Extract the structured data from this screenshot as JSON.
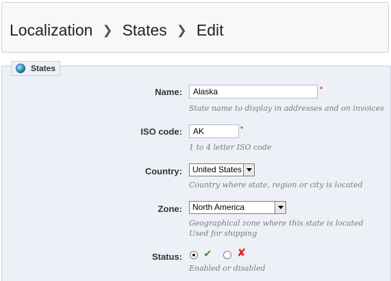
{
  "breadcrumb": {
    "items": [
      "Localization",
      "States",
      "Edit"
    ]
  },
  "fieldset": {
    "legend": "States"
  },
  "form": {
    "name": {
      "label": "Name:",
      "value": "Alaska",
      "required": "*",
      "hint": "State name to display in addresses and on invoices"
    },
    "iso_code": {
      "label": "ISO code:",
      "value": "AK",
      "required": "*",
      "hint": "1 to 4 letter ISO code"
    },
    "country": {
      "label": "Country:",
      "selected": "United States",
      "hint": "Country where state, region or city is located"
    },
    "zone": {
      "label": "Zone:",
      "selected": "North America",
      "hint_line1": "Geographical zone where this state is located",
      "hint_line2": "Used for shipping"
    },
    "status": {
      "label": "Status:",
      "enabled": true,
      "hint": "Enabled or disabled"
    }
  },
  "colors": {
    "panel_bg": "#eef0f7",
    "required": "#cc0000",
    "enabled_icon": "#3a9a1e",
    "disabled_icon": "#e02020"
  }
}
